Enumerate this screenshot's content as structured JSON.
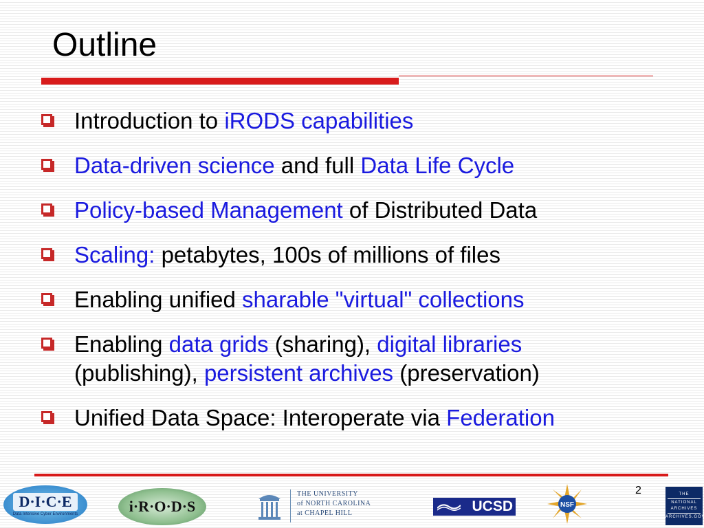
{
  "slide": {
    "title": "Outline",
    "page_number": "2",
    "bullets": [
      {
        "parts": [
          {
            "text": "Introduction to ",
            "highlight": false
          },
          {
            "text": "iRODS capabilities",
            "highlight": true
          }
        ]
      },
      {
        "parts": [
          {
            "text": "Data-driven science",
            "highlight": true
          },
          {
            "text": " and full ",
            "highlight": false
          },
          {
            "text": "Data Life Cycle",
            "highlight": true
          }
        ]
      },
      {
        "parts": [
          {
            "text": "Policy-based Management",
            "highlight": true
          },
          {
            "text": " of Distributed Data",
            "highlight": false
          }
        ]
      },
      {
        "parts": [
          {
            "text": "Scaling:",
            "highlight": true
          },
          {
            "text": " petabytes, 100s of millions of files",
            "highlight": false
          }
        ]
      },
      {
        "parts": [
          {
            "text": "Enabling unified ",
            "highlight": false
          },
          {
            "text": "sharable \"virtual\" collections",
            "highlight": true
          }
        ]
      },
      {
        "parts": [
          {
            "text": "Enabling ",
            "highlight": false
          },
          {
            "text": "data grids",
            "highlight": true
          },
          {
            "text": " (sharing), ",
            "highlight": false
          },
          {
            "text": "digital libraries",
            "highlight": true
          },
          {
            "text": " (publishing), ",
            "highlight": false
          },
          {
            "text": "persistent archives",
            "highlight": true
          },
          {
            "text": " (preservation)",
            "highlight": false
          }
        ]
      },
      {
        "parts": [
          {
            "text": "Unified Data Space: Interoperate via ",
            "highlight": false
          },
          {
            "text": "Federation",
            "highlight": true
          }
        ]
      }
    ]
  },
  "logos": {
    "dice": {
      "name": "D·I·C·E",
      "subtitle": "Data Intensive Cyber Environments"
    },
    "irods": {
      "name": "i·R·O·D·S"
    },
    "unc": {
      "line1": "THE UNIVERSITY",
      "line2": "of NORTH CAROLINA",
      "line3": "at CHAPEL HILL"
    },
    "ucsd": {
      "name": "UCSD"
    },
    "nsf": {
      "name": "NSF"
    },
    "nara": {
      "line1": "THE",
      "line2": "NATIONAL",
      "line3": "ARCHIVES",
      "line4": "ARCHIVES.GOV"
    }
  },
  "colors": {
    "accent_red": "#d81b1b",
    "link_blue": "#1a1adf"
  }
}
